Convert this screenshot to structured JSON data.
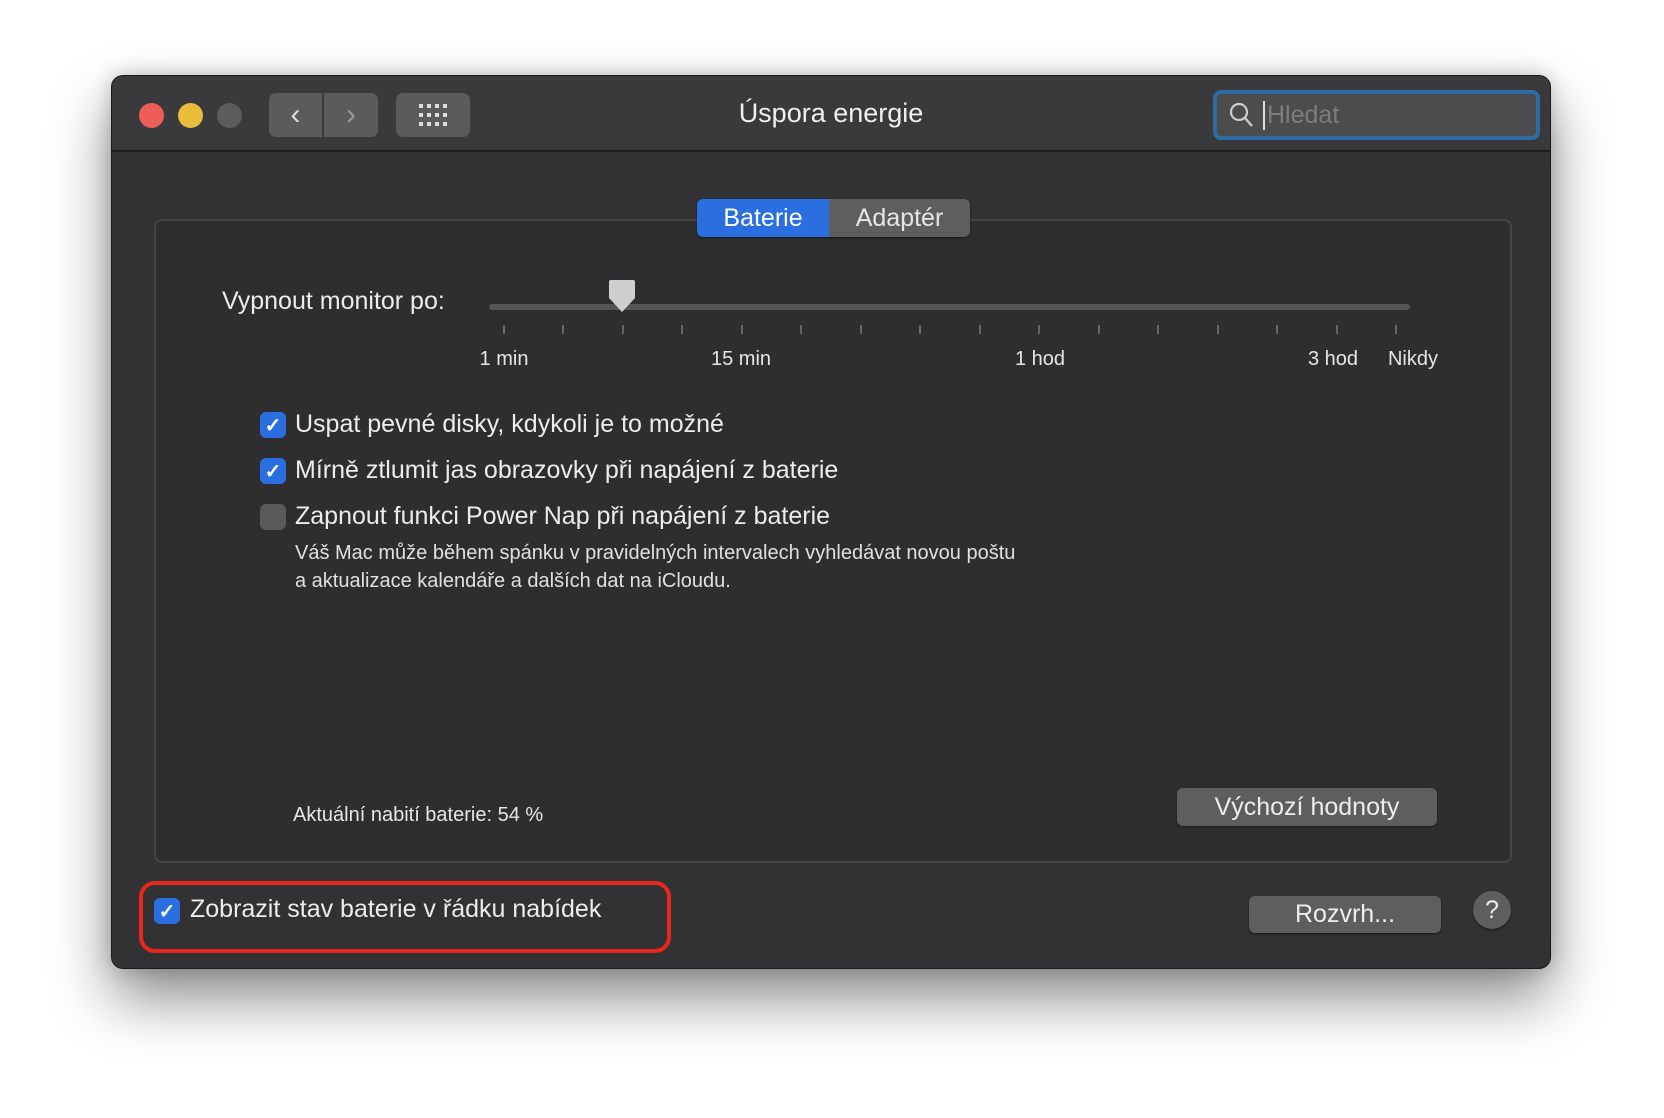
{
  "window": {
    "title": "Úspora energie"
  },
  "toolbar": {
    "search_placeholder": "Hledat"
  },
  "tabs": [
    {
      "label": "Baterie",
      "selected": true
    },
    {
      "label": "Adaptér",
      "selected": false
    }
  ],
  "slider": {
    "label": "Vypnout monitor po:",
    "tick_labels": [
      "1 min",
      "15 min",
      "1 hod",
      "3 hod",
      "Nikdy"
    ],
    "tick_count": 16,
    "selected_tick_index": 2
  },
  "options": [
    {
      "label": "Uspat pevné disky, kdykoli je to možné",
      "checked": true
    },
    {
      "label": "Mírně ztlumit jas obrazovky při napájení z baterie",
      "checked": true
    },
    {
      "label": "Zapnout funkci Power Nap při napájení z baterie",
      "checked": false,
      "description": [
        "Váš Mac může během spánku v pravidelných intervalech vyhledávat novou poštu",
        "a aktualizace kalendáře a dalších dat na iCloudu."
      ]
    }
  ],
  "battery_status": "Aktuální nabití baterie: 54 %",
  "defaults_button": "Výchozí hodnoty",
  "show_battery": {
    "label": "Zobrazit stav baterie v řádku nabídek",
    "checked": true
  },
  "schedule_button": "Rozvrh...",
  "help_button": "?",
  "colors": {
    "accent": "#2a6ee0",
    "highlight": "#e8261e"
  }
}
